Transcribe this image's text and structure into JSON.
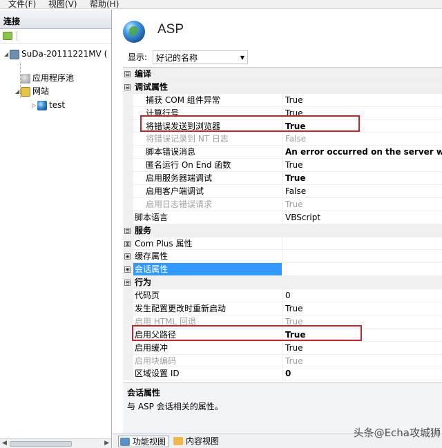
{
  "menu": {
    "file": "文件(F)",
    "view": "视图(V)",
    "help": "帮助(H)"
  },
  "left": {
    "header": "连接",
    "tree": {
      "server": "SuDa-20111221MV (",
      "app_pools": "应用程序池",
      "sites": "网站",
      "site_test": "test"
    }
  },
  "main": {
    "title": "ASP",
    "display_label": "显示:",
    "display_value": "好记的名称",
    "description": {
      "title": "会话属性",
      "text": "与 ASP 会话相关的属性。"
    },
    "view_tabs": {
      "features": "功能视图",
      "content": "内容视图"
    }
  },
  "grid": {
    "cat_compile": {
      "name": "编译",
      "ctl": "⊟"
    },
    "cat_debug": {
      "name": "调试属性",
      "ctl": "⊟"
    },
    "r_capture_com": {
      "name": "捕获 COM 组件异常",
      "value": "True"
    },
    "r_calc_line": {
      "name": "计算行号",
      "value": "True"
    },
    "r_send_errors": {
      "name": "将错误发送到浏览器",
      "value": "True"
    },
    "r_log_nt": {
      "name": "将错误记录到 NT 日志",
      "value": "False"
    },
    "r_script_error": {
      "name": "脚本错误消息",
      "value": "An error occurred on the server wh"
    },
    "r_anon_onend": {
      "name": "匿名运行 On End 函数",
      "value": "True"
    },
    "r_server_debug": {
      "name": "启用服务器端调试",
      "value": "True"
    },
    "r_client_debug": {
      "name": "启用客户端调试",
      "value": "False"
    },
    "r_log_requests": {
      "name": "启用日志错误请求",
      "value": "True"
    },
    "r_script_lang": {
      "name": "脚本语言",
      "value": "VBScript"
    },
    "cat_services": {
      "name": "服务",
      "ctl": "⊟"
    },
    "r_complus": {
      "name": "Com Plus 属性",
      "ctl": "⊞"
    },
    "r_cache": {
      "name": "缓存属性",
      "ctl": "⊞"
    },
    "r_session": {
      "name": "会话属性",
      "ctl": "⊞"
    },
    "cat_behavior": {
      "name": "行为",
      "ctl": "⊟"
    },
    "r_codepage": {
      "name": "代码页",
      "value": "0"
    },
    "r_restart_on_change": {
      "name": "发生配置更改时重新启动",
      "value": "True"
    },
    "r_html_fallback": {
      "name": "启用 HTML 回退",
      "value": "True"
    },
    "r_parent_paths": {
      "name": "启用父路径",
      "value": "True"
    },
    "r_buffering": {
      "name": "启用缓冲",
      "value": "True"
    },
    "r_chunked": {
      "name": "启用块编码",
      "value": "True"
    },
    "r_locale": {
      "name": "区域设置 ID",
      "value": "0"
    }
  },
  "watermark": "头条@Echa攻城狮"
}
